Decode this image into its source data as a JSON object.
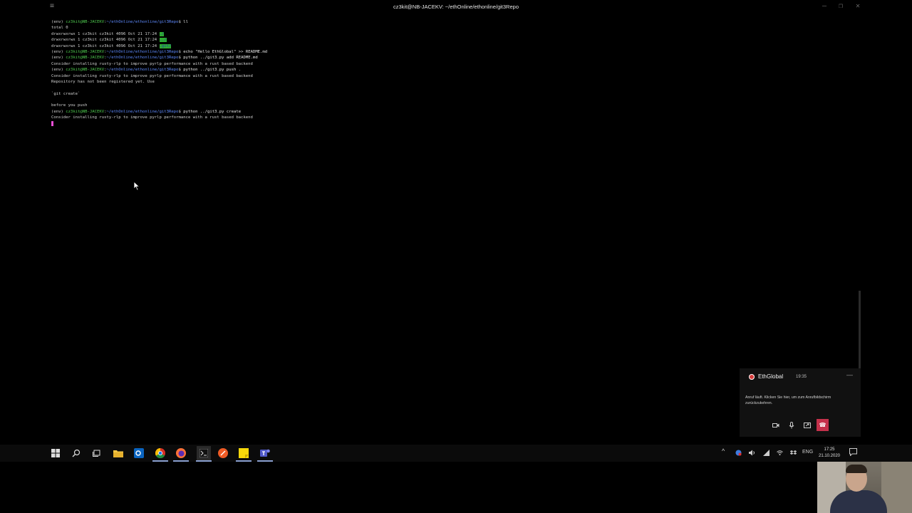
{
  "window": {
    "menu_icon": "≡",
    "title": "cz3kit@NB-JACEKV: ~/ethOnline/ethonline/git3Repo",
    "min": "–",
    "max": "❐",
    "close": "✕"
  },
  "terminal": {
    "prompt_env": "(env) ",
    "prompt_user": "cz3kit@NB-JACEKV",
    "prompt_colon": ":",
    "prompt_path": "~/ethOnline/ethonline/git3Repo",
    "prompt_dollar": "$ ",
    "cmd_ll": "ll",
    "total": "total 0",
    "dir_perm": "drwxrwxrwx 1 cz3kit cz3kit 4096 Oct 21 17:24 ",
    "dir1": "./",
    "dir2": "../",
    "dir3": ".git/",
    "cmd_echo": "echo \"Hello EthGlobal\" >> README.md",
    "cmd_add": "python ../git3.py add README.md",
    "msg_rlp": "Consider installing rusty-rlp to improve pyrlp performance with a rust based backend",
    "cmd_push": "python ../git3.py push .",
    "msg_not_registered": "Repository has not been registered yet. Use",
    "msg_git_create": "`git create`",
    "msg_before_push": "before you push",
    "cmd_create": "python ../git3.py create"
  },
  "call": {
    "name": "EthGlobal",
    "time": "19:35",
    "minimize": "—",
    "message": "Anruf läuft. Klicken Sie hier, um zum Anrufbildschirm zurückzukehren.",
    "hangup_icon": "☎"
  },
  "taskbar": {
    "icons": [
      "windows-start-icon",
      "search-icon",
      "task-view-icon",
      "file-explorer-icon",
      "outlook-icon",
      "chrome-icon",
      "firefox-icon",
      "terminal-icon",
      "postman-icon",
      "sticky-notes-icon",
      "teams-icon"
    ],
    "language": "ENG",
    "time": "17:25",
    "date": "21.10.2020"
  },
  "colors": {
    "user": "#4ec94e",
    "path": "#5f8bff",
    "dir_highlight": "#2fae2f",
    "cursor": "#e94fd6",
    "hangup": "#c4314b"
  }
}
